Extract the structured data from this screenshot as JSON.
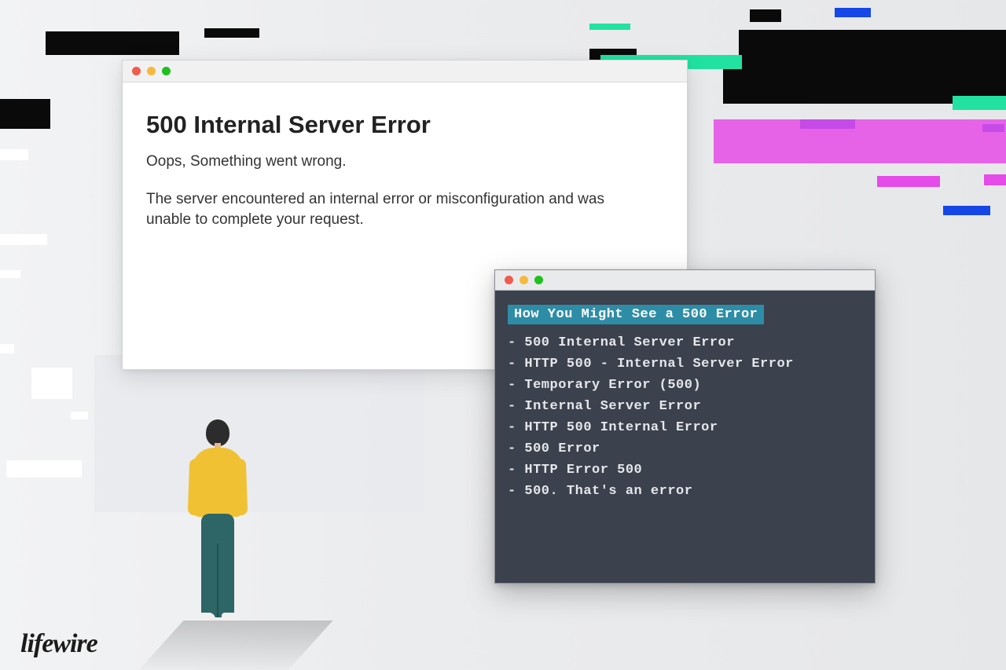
{
  "colors": {
    "accent_teal": "#21e2a1",
    "accent_blue": "#1447e5",
    "accent_magenta": "#e54be8",
    "dark": "#0a0a0a",
    "terminal_bg": "#3b414d"
  },
  "browser": {
    "title": "500 Internal Server Error",
    "subtitle": "Oops, Something went wrong.",
    "description": "The server encountered an internal error or misconfiguration and was unable to complete your request.",
    "traffic_lights": [
      "red",
      "yellow",
      "green"
    ]
  },
  "terminal": {
    "heading": "How You Might See a 500 Error",
    "items": [
      "500 Internal Server Error",
      "HTTP 500 - Internal Server Error",
      "Temporary Error (500)",
      "Internal Server Error",
      "HTTP 500 Internal Error",
      "500 Error",
      "HTTP Error 500",
      "500. That's an error"
    ]
  },
  "brand": "lifewire"
}
